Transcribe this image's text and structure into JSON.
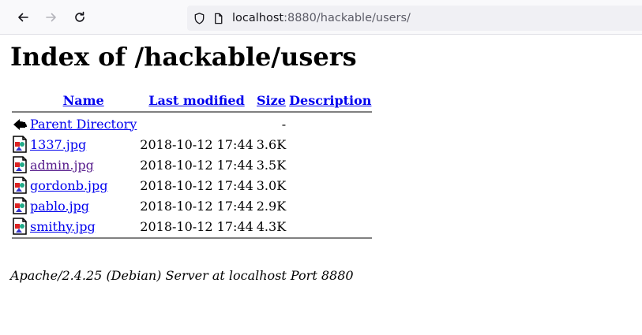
{
  "browser": {
    "url_host": "localhost",
    "url_rest": ":8880/hackable/users/"
  },
  "page": {
    "title": "Index of /hackable/users",
    "headers": {
      "name": "Name",
      "last_modified": "Last modified",
      "size": "Size",
      "description": "Description"
    },
    "parent": {
      "name": "Parent Directory",
      "size": "-"
    },
    "files": [
      {
        "name": "1337.jpg",
        "modified": "2018-10-12 17:44",
        "size": "3.6K",
        "visited": false
      },
      {
        "name": "admin.jpg",
        "modified": "2018-10-12 17:44",
        "size": "3.5K",
        "visited": true
      },
      {
        "name": "gordonb.jpg",
        "modified": "2018-10-12 17:44",
        "size": "3.0K",
        "visited": false
      },
      {
        "name": "pablo.jpg",
        "modified": "2018-10-12 17:44",
        "size": "2.9K",
        "visited": false
      },
      {
        "name": "smithy.jpg",
        "modified": "2018-10-12 17:44",
        "size": "4.3K",
        "visited": false
      }
    ],
    "footer": "Apache/2.4.25 (Debian) Server at localhost Port 8880"
  },
  "colors": {
    "link": "#0000ee",
    "visited": "#551a8b",
    "rule": "#808080"
  },
  "icons": {
    "back": "arrow-left-icon",
    "forward": "arrow-right-icon",
    "reload": "reload-icon",
    "tracking": "shield-icon",
    "page": "page-icon",
    "parent": "back-folder-icon",
    "file": "image-file-icon"
  }
}
